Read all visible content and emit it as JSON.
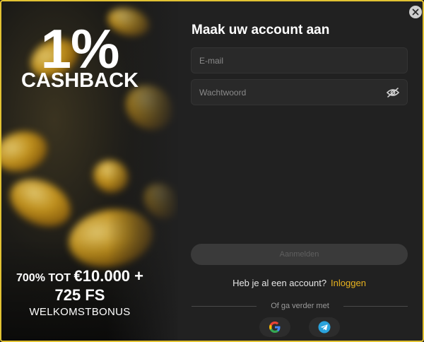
{
  "promo": {
    "headline": "1%",
    "subheadline": "CASHBACK",
    "bonus_prefix": "700% TOT ",
    "bonus_amount": "€10.000 +",
    "bonus_fs": "725 FS",
    "bonus_label": "WELKOMSTBONUS"
  },
  "form": {
    "title": "Maak uw account aan",
    "email_placeholder": "E-mail",
    "password_placeholder": "Wachtwoord",
    "submit_label": "Aanmelden",
    "have_account_text": "Heb je al een account?",
    "login_label": "Inloggen",
    "divider_text": "Of ga verder met"
  },
  "social": [
    "google-icon",
    "telegram-icon"
  ],
  "colors": {
    "accent": "#e8b21f",
    "border": "#e2c233",
    "background": "#212121",
    "field": "#292929"
  }
}
